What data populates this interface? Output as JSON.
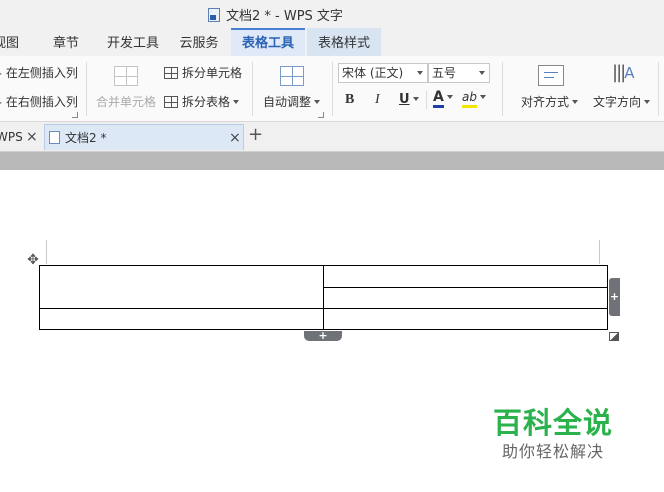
{
  "window": {
    "title": "文档2 * - WPS 文字"
  },
  "menu": {
    "tabs": [
      {
        "label": "视图"
      },
      {
        "label": "章节"
      },
      {
        "label": "开发工具"
      },
      {
        "label": "云服务"
      },
      {
        "label": "表格工具"
      },
      {
        "label": "表格样式"
      }
    ],
    "active_tab": "表格工具"
  },
  "ribbon": {
    "insert_left_col": "在左侧插入列",
    "insert_right_col": "在右侧插入列",
    "merge_cells": "合并单元格",
    "split_cells": "拆分单元格",
    "split_table": "拆分表格",
    "auto_fit": "自动调整",
    "font_name": "宋体 (正文)",
    "font_size": "五号",
    "bold": "B",
    "italic": "I",
    "underline": "U",
    "font_color_glyph": "A",
    "highlight_glyph": "ab",
    "align": "对齐方式",
    "text_direction": "文字方向",
    "text_direction_glyph": "A"
  },
  "doc_tabs": {
    "tab1": "WPS",
    "tab2": "文档2 *",
    "close_glyph": "×",
    "new_tab_glyph": "+"
  },
  "table": {
    "add_glyph": "+",
    "move_glyph": "✥"
  },
  "watermark": {
    "title": "百科全说",
    "subtitle": "助你轻松解决"
  },
  "colors": {
    "accent": "#2b63b5",
    "font_color_bar": "#1f3fa8",
    "highlight_bar": "#f2e600",
    "watermark_green": "#2bb24c"
  }
}
